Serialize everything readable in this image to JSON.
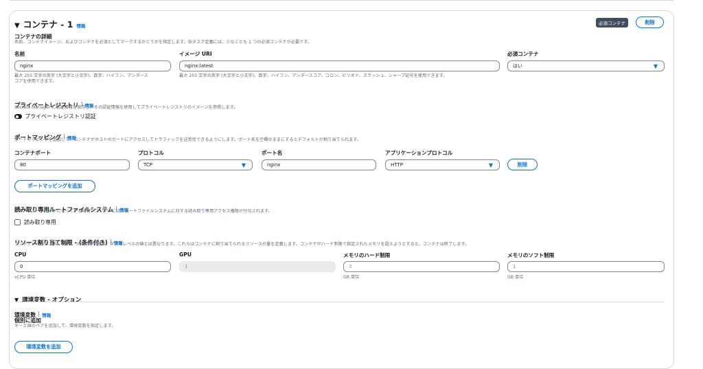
{
  "container": {
    "title": "コンテナ - 1",
    "info": "情報",
    "essential_badge": "必須コンテナ",
    "delete_label": "削除"
  },
  "details": {
    "title": "コンテナの詳細",
    "description": "名前、コンテナイメージ、およびコンテナを必須としてマークするかどうかを指定します。各タスク定義には、少なくとも 1 つの必須コンテナが必要です。",
    "name_label": "名前",
    "name_value": "nginx",
    "name_hint_line1": "最大 255 文字の英字 (大文字と小文字)、数字、ハイフン、アンダース",
    "name_hint_line2": "コアを使用できます。",
    "image_label": "イメージ URI",
    "image_value": "nginx:latest",
    "image_hint": "最大 255 文字の英字 (大文字と小文字)、数字、ハイフン、アンダースコア、コロン、ピリオド、スラッシュ、シャープ記号を使用できます。",
    "essential_label": "必須コンテナ",
    "essential_value": "はい"
  },
  "registry": {
    "title": "プライベートレジストリ",
    "info": "情報",
    "description": "Secrets Manager に認証情報を保存し、その認証情報を使用してプライベートレジストリのイメージを参照します。",
    "toggle_label": "プライベートレジストリ認証"
  },
  "port_mapping": {
    "title": "ポートマッピング",
    "info": "情報",
    "description": "ポートマッピングを追加して、コンテナがホストのポートにアクセスしてトラフィックを送受信できるようにします。ポート名を空欄のままにするとデフォルトが割り当てられます。",
    "container_port_label": "コンテナポート",
    "container_port_value": "80",
    "protocol_label": "プロトコル",
    "protocol_value": "TCP",
    "port_name_label": "ポート名",
    "port_name_value": "nginx",
    "app_protocol_label": "アプリケーションプロトコル",
    "app_protocol_value": "HTTP",
    "remove_label": "削除",
    "add_label": "ポートマッピングを追加"
  },
  "readonly_fs": {
    "title": "読み取り専用ルートファイルシステム",
    "info": "情報",
    "description": "このパラメータがオンになっている場合、コンテナには、ルートファイルシステムに対する読み取り専用アクセス権限が付与されます。",
    "checkbox_label": "読み取り専用"
  },
  "resources": {
    "title": "リソース割り当て制限 - (条件付き)",
    "info": "情報",
    "description": "コンテナレベルの CPU、GPU、メモリの制限は、タスクレベルの値とは異なります。これらはコンテナに割り当てられるリソースの量を定義します。コンテナがハード制限で指定されたメモリを超えようとすると、コンテナは終了します。",
    "cpu_label": "CPU",
    "cpu_value": "0",
    "cpu_unit": "vCPU 単位",
    "gpu_label": "GPU",
    "gpu_value": "1",
    "mem_hard_label": "メモリのハード制限",
    "mem_hard_value": "3",
    "mem_hard_unit": "GB 単位",
    "mem_soft_label": "メモリのソフト制限",
    "mem_soft_value": "1",
    "mem_soft_unit": "GB 単位"
  },
  "env": {
    "title": "環境変数 - オプション",
    "sub_title": "環境変数",
    "info": "情報",
    "individual_title": "個別に追加",
    "individual_description": "キーと値のペアを追加して、環境変数を指定します。",
    "add_label": "環境変数を追加"
  }
}
